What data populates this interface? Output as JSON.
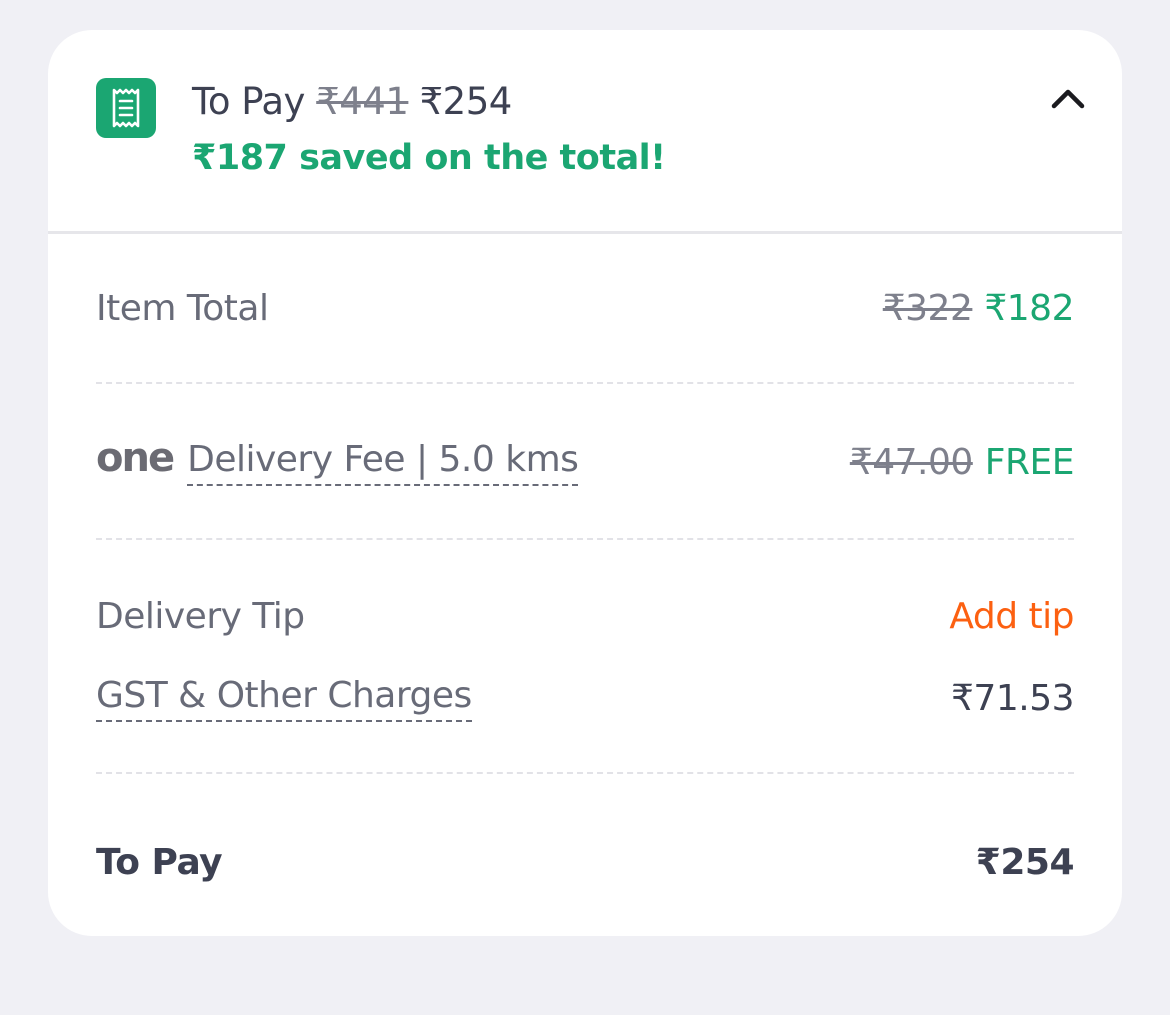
{
  "header": {
    "title_label": "To Pay",
    "original_total": "₹441",
    "final_total": "₹254",
    "savings_text": "₹187 saved on the total!",
    "receipt_icon": "receipt-icon",
    "collapse_icon": "chevron-up-icon"
  },
  "rows": {
    "item_total": {
      "label": "Item Total",
      "original": "₹322",
      "value": "₹182"
    },
    "delivery_fee": {
      "brand": "one",
      "label": "Delivery Fee | 5.0 kms",
      "original": "₹47.00",
      "value": "FREE"
    },
    "delivery_tip": {
      "label": "Delivery Tip",
      "action": "Add tip"
    },
    "gst": {
      "label": "GST & Other Charges",
      "value": "₹71.53"
    },
    "to_pay": {
      "label": "To Pay",
      "value": "₹254"
    }
  },
  "colors": {
    "accent_green": "#1ba672",
    "accent_orange": "#fc6011",
    "text_dark": "#3d4152",
    "text_muted": "#686b78"
  }
}
